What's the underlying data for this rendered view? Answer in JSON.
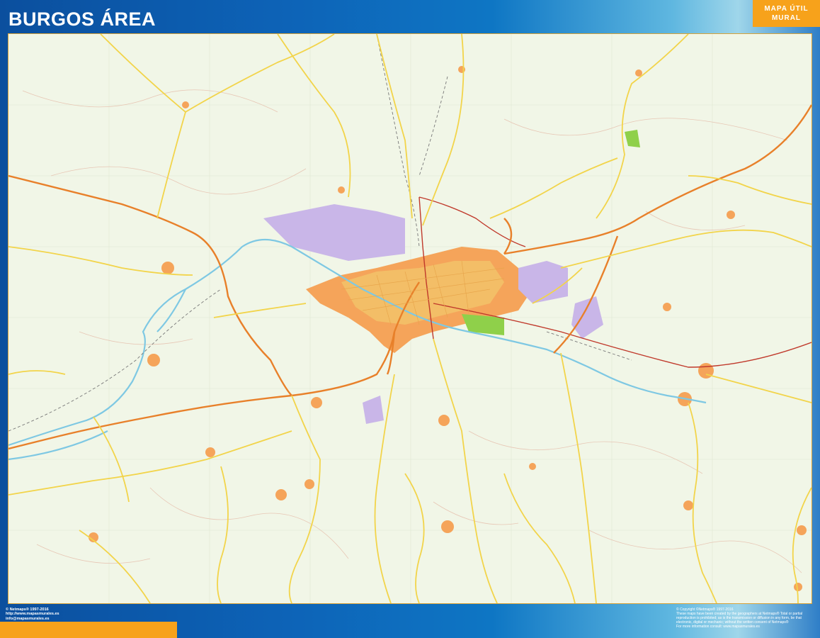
{
  "header": {
    "title": "BURGOS ÁREA",
    "badge_line1": "MAPA ÚTIL",
    "badge_line2": "MURAL"
  },
  "footer": {
    "left_line1": "© Netmaps® 1997-2016",
    "left_line2": "http://www.mapasmurales.es",
    "left_line3": "info@mapasmurales.es",
    "right_line1": "© Copyright ©Netmaps® 1997-2016",
    "right_line2": "These maps have been created by the geographers at Netmaps® Total or partial",
    "right_line3": "reproduction is prohibited; as is the transmission or diffusion in any form, be that",
    "right_line4": "electronic, digital or mechanic; without the written consent of Netmaps®",
    "right_line5": "For more information consult: www.mapasmurales.es"
  },
  "colors": {
    "frame_blue": "#0b4f9e",
    "accent_orange": "#f7a21b",
    "map_background": "#f1f6e7",
    "motorway": "#e8802a",
    "main_road": "#f2d44a",
    "railway": "#c0392b",
    "river": "#7ec8e3",
    "urban": "#f5a45a",
    "industrial": "#c9b6e8",
    "park": "#8fd04a"
  }
}
